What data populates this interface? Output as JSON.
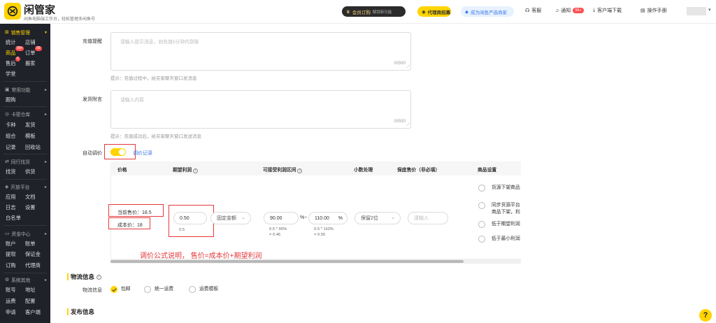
{
  "header": {
    "brand": "闲管家",
    "slogan": "闲鱼电脑端工作台，轻松管理多闲鱼号",
    "member_label": "会员订购",
    "member_sub": "解锁新功能",
    "agent_label": "代理商招募",
    "dealer_label": "成为闲鱼严选商家",
    "service": "客服",
    "notice": "通知",
    "notice_badge": "99+",
    "download": "客户端下载",
    "manual": "操作手册"
  },
  "sidebar": {
    "sections": [
      {
        "label": "销售管理",
        "active": true
      },
      {
        "label": "常用功能"
      },
      {
        "label": "卡密仓库"
      },
      {
        "label": "同行找货"
      },
      {
        "label": "开放平台"
      },
      {
        "label": "资金中心"
      },
      {
        "label": "系统其他"
      }
    ],
    "items": {
      "stats": "统计",
      "shop": "店铺",
      "goods": "商品",
      "goods_badge": "99+",
      "orders": "订单",
      "orders_badge": "99",
      "aftersale": "售后",
      "aftersale_badge": "6",
      "move": "搬家",
      "learn": "学堂",
      "tracking": "跟购",
      "cardtype": "卡种",
      "deliver": "发货",
      "combo": "组合",
      "template": "模板",
      "record": "记录",
      "recycle": "回收站",
      "findgoods": "找货",
      "supply": "供货",
      "apply": "应用",
      "docs": "文档",
      "log": "日志",
      "settings": "设置",
      "whitelist": "白名单",
      "account": "账户",
      "bill": "账单",
      "withdraw": "提现",
      "deposit": "保证金",
      "subscribe": "订购",
      "agent": "代理商",
      "accounts": "账号",
      "address": "地址",
      "freight": "运费",
      "config": "配置",
      "apply2": "申请",
      "client": "客户端"
    }
  },
  "form": {
    "recharge_label": "充值提醒",
    "recharge_placeholder": "请输入提示消息，如充值5分钟内到账",
    "recharge_count": "0/500",
    "recharge_hint": "提示：充值过程中，给买家聊天窗口发消息",
    "attach_label": "发货附言",
    "attach_placeholder": "请输入内容",
    "attach_count": "0/500",
    "attach_hint": "提示：充值成功后，给买家聊天窗口发送消息",
    "auto_price_label": "自动调价",
    "auto_price_on": true,
    "price_record_link": "调价记录"
  },
  "table": {
    "headers": [
      "价格",
      "期望利润",
      "可接受利润区间",
      "小数处理",
      "保底售价（非必填）",
      "商品设置"
    ],
    "current_price": "当前售价：18.5",
    "cost_price": "成本价：18",
    "profit_value": "0.50",
    "profit_sub": "0.5",
    "profit_type": "固定金额",
    "range_low": "90.00",
    "range_pct": "%~",
    "range_high": "110.00",
    "range_pct2": "%",
    "low_calc_1": "0.5 * 90%",
    "low_calc_2": "= 0.45",
    "high_calc_1": "0.5 * 110%",
    "high_calc_2": "= 0.55",
    "decimal": "保留2位",
    "floor_placeholder": "请输入",
    "settings": [
      "货源下架商品",
      "同步货源平台\n商品下架，利",
      "低于期望利润",
      "低于最小利润"
    ]
  },
  "annotation": "调价公式说明， 售价=成本价+期望利润",
  "logistics": {
    "title": "物流信息",
    "label": "物流信息",
    "options": [
      "包邮",
      "统一运费",
      "运费模板"
    ],
    "selected": "包邮"
  },
  "publish": {
    "title": "发布信息"
  },
  "help_label": "?"
}
